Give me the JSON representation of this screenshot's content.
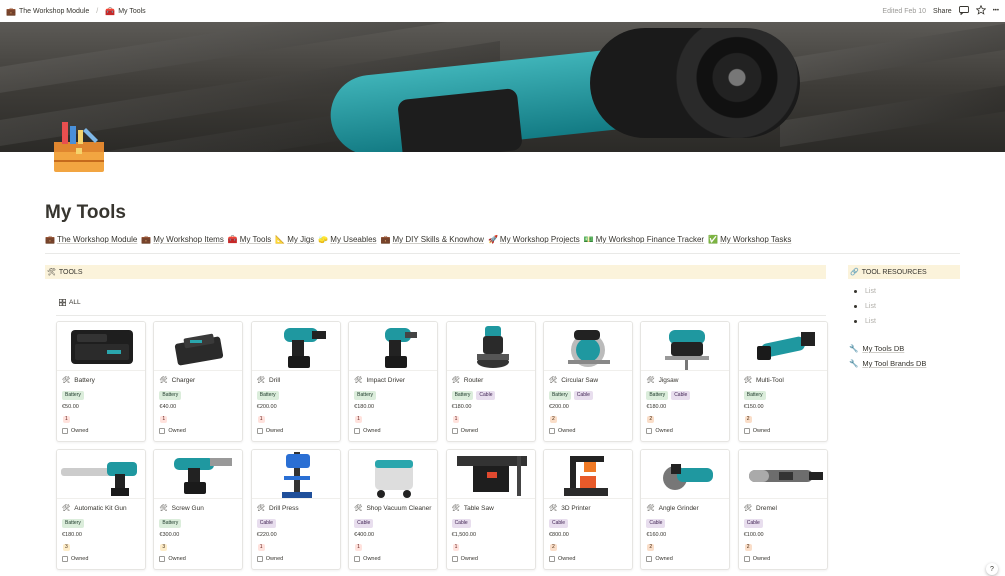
{
  "breadcrumb": {
    "parent": "The Workshop Module",
    "current": "My Tools",
    "parent_emoji": "💼",
    "current_emoji": "🧰"
  },
  "topbar": {
    "edited": "Edited Feb 10",
    "share": "Share",
    "comment_icon": "comment-icon",
    "star_icon": "star-icon",
    "more": "•••"
  },
  "page": {
    "title": "My Tools",
    "icon": "toolbox-icon"
  },
  "links": [
    {
      "emoji": "💼",
      "label": "The Workshop Module"
    },
    {
      "emoji": "💼",
      "label": "My Workshop Items"
    },
    {
      "emoji": "🧰",
      "label": "My Tools"
    },
    {
      "emoji": "📐",
      "label": "My Jigs"
    },
    {
      "emoji": "🧽",
      "label": "My Useables"
    },
    {
      "emoji": "💼",
      "label": "My DIY Skills & Knowhow"
    },
    {
      "emoji": "🚀",
      "label": "My Workshop Projects"
    },
    {
      "emoji": "💵",
      "label": "My Workshop Finance Tracker"
    },
    {
      "emoji": "✅",
      "label": "My Workshop Tasks"
    }
  ],
  "tools_section": {
    "emoji": "🛠",
    "heading": "TOOLS",
    "view_label": "ALL"
  },
  "resources": {
    "emoji": "🔗",
    "heading": "TOOL RESOURCES",
    "list_items": [
      "List",
      "List",
      "List"
    ],
    "links": [
      {
        "emoji": "🔧",
        "label": "My Tools DB"
      },
      {
        "emoji": "🔧",
        "label": "My Tool Brands DB"
      }
    ]
  },
  "owned_label": "Owned",
  "card_emoji": "🛠",
  "cards": [
    {
      "name": "Battery",
      "tags": [
        "Battery"
      ],
      "price": "€50.00",
      "qty": "1",
      "qty_class": "q1",
      "image": "battery-image"
    },
    {
      "name": "Charger",
      "tags": [
        "Battery"
      ],
      "price": "€40.00",
      "qty": "1",
      "qty_class": "q1",
      "image": "charger-image"
    },
    {
      "name": "Drill",
      "tags": [
        "Battery"
      ],
      "price": "€200.00",
      "qty": "1",
      "qty_class": "q1",
      "image": "drill-image"
    },
    {
      "name": "Impact Driver",
      "tags": [
        "Battery"
      ],
      "price": "€180.00",
      "qty": "1",
      "qty_class": "q1",
      "image": "impact-driver-image"
    },
    {
      "name": "Router",
      "tags": [
        "Battery",
        "Cable"
      ],
      "price": "€180.00",
      "qty": "1",
      "qty_class": "q1",
      "image": "router-image"
    },
    {
      "name": "Circular Saw",
      "tags": [
        "Battery",
        "Cable"
      ],
      "price": "€200.00",
      "qty": "2",
      "qty_class": "q2",
      "image": "circular-saw-image"
    },
    {
      "name": "Jigsaw",
      "tags": [
        "Battery",
        "Cable"
      ],
      "price": "€180.00",
      "qty": "2",
      "qty_class": "q2",
      "image": "jigsaw-image"
    },
    {
      "name": "Multi-Tool",
      "tags": [
        "Battery"
      ],
      "price": "€150.00",
      "qty": "2",
      "qty_class": "q2",
      "image": "multi-tool-image"
    },
    {
      "name": "Automatic Kit Gun",
      "tags": [
        "Battery"
      ],
      "price": "€180.00",
      "qty": "3",
      "qty_class": "q3",
      "image": "kit-gun-image"
    },
    {
      "name": "Screw Gun",
      "tags": [
        "Battery"
      ],
      "price": "€300.00",
      "qty": "3",
      "qty_class": "q3",
      "image": "screw-gun-image"
    },
    {
      "name": "Drill Press",
      "tags": [
        "Cable"
      ],
      "price": "€220.00",
      "qty": "1",
      "qty_class": "q1",
      "image": "drill-press-image"
    },
    {
      "name": "Shop Vacuum Cleaner",
      "tags": [
        "Cable"
      ],
      "price": "€400.00",
      "qty": "1",
      "qty_class": "q1",
      "image": "vacuum-image"
    },
    {
      "name": "Table Saw",
      "tags": [
        "Cable"
      ],
      "price": "€1,500.00",
      "qty": "1",
      "qty_class": "q1",
      "image": "table-saw-image"
    },
    {
      "name": "3D Printer",
      "tags": [
        "Cable"
      ],
      "price": "€800.00",
      "qty": "2",
      "qty_class": "q2",
      "image": "3d-printer-image"
    },
    {
      "name": "Angle Grinder",
      "tags": [
        "Cable"
      ],
      "price": "€160.00",
      "qty": "2",
      "qty_class": "q2",
      "image": "angle-grinder-image"
    },
    {
      "name": "Dremel",
      "tags": [
        "Cable"
      ],
      "price": "€100.00",
      "qty": "2",
      "qty_class": "q2",
      "image": "dremel-image"
    }
  ],
  "help": "?"
}
